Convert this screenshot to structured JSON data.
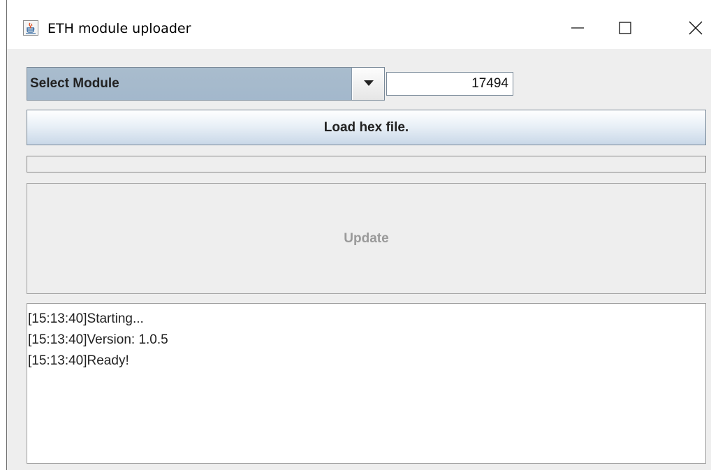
{
  "window": {
    "title": "ETH module uploader",
    "icon": "java-cup-icon",
    "controls": [
      "minimize-icon",
      "maximize-icon",
      "close-icon"
    ]
  },
  "module_select": {
    "selected": "Select Module",
    "arrow_icon": "chevron-down-icon"
  },
  "port_field": {
    "value": "17494"
  },
  "load_button": {
    "label": "Load hex file."
  },
  "progress": {
    "value_percent": 0
  },
  "update_button": {
    "label": "Update",
    "enabled": false
  },
  "log": {
    "lines": [
      "[15:13:40]Starting...",
      "[15:13:40]Version: 1.0.5",
      "[15:13:40]Ready!"
    ]
  },
  "colors": {
    "window_bg": "#eeeeee",
    "combo_bg": "#a9bccd",
    "disabled_text": "#9a9a9a"
  }
}
